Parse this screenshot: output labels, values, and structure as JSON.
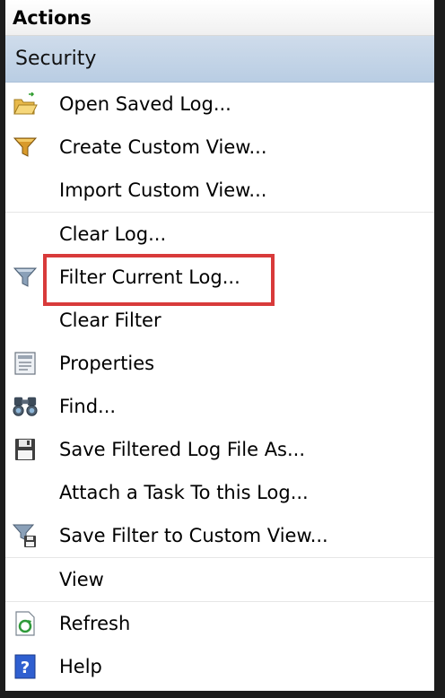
{
  "panel": {
    "header": "Actions",
    "section": "Security"
  },
  "items": [
    {
      "label": "Open Saved Log...",
      "icon": "open-folder-icon"
    },
    {
      "label": "Create Custom View...",
      "icon": "filter-funnel-icon"
    },
    {
      "label": "Import Custom View...",
      "icon": ""
    },
    {
      "label": "Clear Log...",
      "icon": ""
    },
    {
      "label": "Filter Current Log...",
      "icon": "filter-funnel-icon"
    },
    {
      "label": "Clear Filter",
      "icon": ""
    },
    {
      "label": "Properties",
      "icon": "properties-icon"
    },
    {
      "label": "Find...",
      "icon": "binoculars-icon"
    },
    {
      "label": "Save Filtered Log File As...",
      "icon": "save-disk-icon"
    },
    {
      "label": "Attach a Task To this Log...",
      "icon": ""
    },
    {
      "label": "Save Filter to Custom View...",
      "icon": "save-filter-icon"
    },
    {
      "label": "View",
      "icon": ""
    },
    {
      "label": "Refresh",
      "icon": "refresh-icon"
    },
    {
      "label": "Help",
      "icon": "help-icon"
    }
  ],
  "highlight": {
    "target": "Filter Current Log...",
    "color": "#d83a3a"
  }
}
